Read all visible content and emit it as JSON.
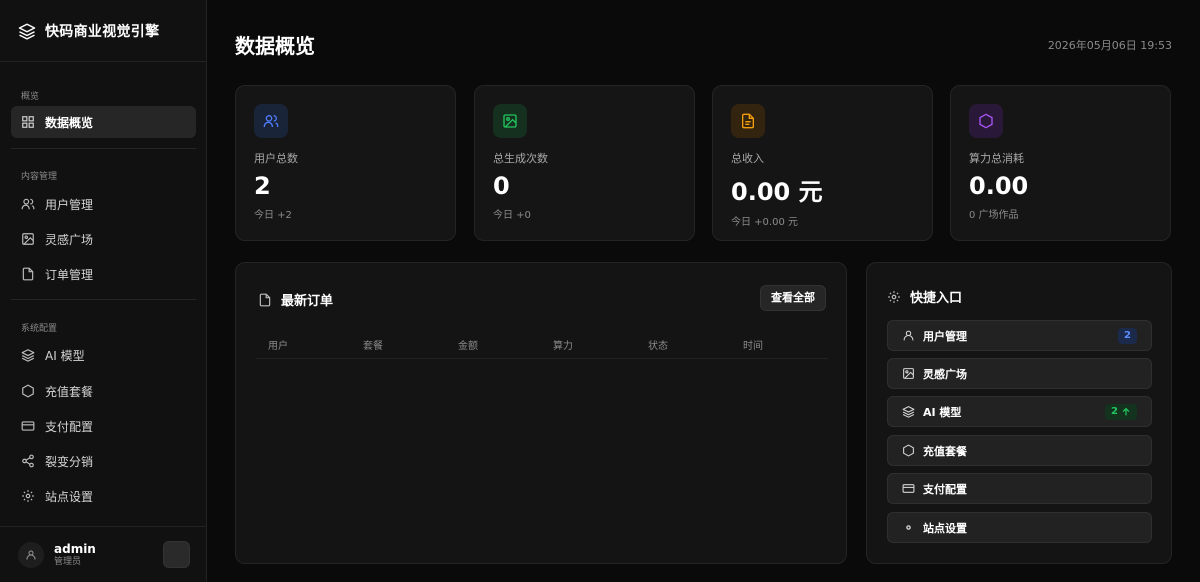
{
  "brand": {
    "name": "快码商业视觉引擎"
  },
  "sidebar": {
    "sections": [
      {
        "label": "概览"
      },
      {
        "label": "内容管理"
      },
      {
        "label": "系统配置"
      }
    ],
    "items": [
      {
        "label": "数据概览",
        "icon": "grid-icon"
      },
      {
        "label": "用户管理",
        "icon": "users-icon"
      },
      {
        "label": "灵感广场",
        "icon": "image-icon"
      },
      {
        "label": "订单管理",
        "icon": "file-icon"
      },
      {
        "label": "AI 模型",
        "icon": "layers-icon"
      },
      {
        "label": "充值套餐",
        "icon": "hexagon-icon"
      },
      {
        "label": "支付配置",
        "icon": "credit-card-icon"
      },
      {
        "label": "裂变分销",
        "icon": "share-icon"
      },
      {
        "label": "站点设置",
        "icon": "gear-icon"
      }
    ],
    "user": {
      "name": "admin",
      "role": "管理员"
    }
  },
  "header": {
    "title": "数据概览",
    "datetime": "2026年05月06日 19:53"
  },
  "stats": [
    {
      "label": "用户总数",
      "value": "2",
      "sub": "今日 +2",
      "icon": "users-icon",
      "color": "#4f7cff"
    },
    {
      "label": "总生成次数",
      "value": "0",
      "sub": "今日 +0",
      "icon": "image-icon",
      "color": "#22c55e"
    },
    {
      "label": "总收入",
      "value": "0.00 元",
      "sub": "今日 +0.00 元",
      "icon": "file-icon",
      "color": "#f59e0b"
    },
    {
      "label": "算力总消耗",
      "value": "0.00",
      "sub": "0 广场作品",
      "icon": "hexagon-icon",
      "color": "#a855f7"
    }
  ],
  "orders": {
    "title": "最新订单",
    "view_all": "查看全部",
    "columns": [
      "用户",
      "套餐",
      "金额",
      "算力",
      "状态",
      "时间"
    ],
    "rows": []
  },
  "quick": {
    "title": "快捷入口",
    "items": [
      {
        "label": "用户管理",
        "icon": "user-icon",
        "badge": "2"
      },
      {
        "label": "灵感广场",
        "icon": "image-icon"
      },
      {
        "label": "AI 模型",
        "icon": "layers-icon",
        "badge": "2"
      },
      {
        "label": "充值套餐",
        "icon": "hexagon-icon"
      },
      {
        "label": "支付配置",
        "icon": "credit-card-icon"
      },
      {
        "label": "站点设置",
        "icon": "dot-icon"
      }
    ]
  },
  "colors": {
    "badge_blue": "#3b82f6",
    "badge_green": "#22c55e"
  }
}
